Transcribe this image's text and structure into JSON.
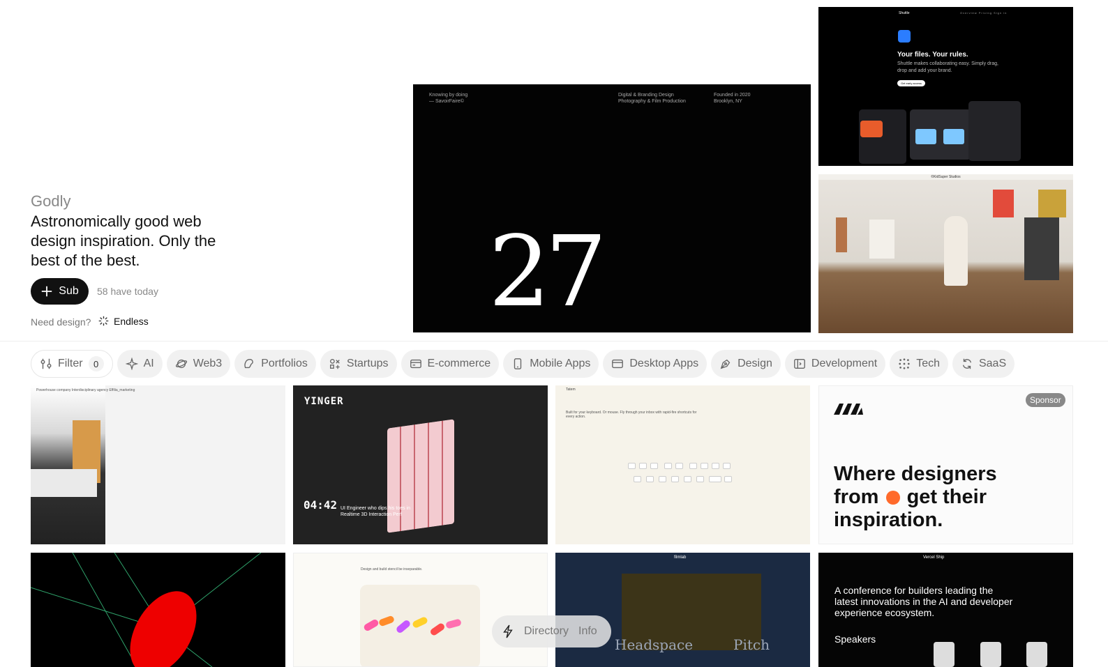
{
  "hero": {
    "brand": "Godly",
    "tagline": "Astronomically good web design inspiration. Only the best of the best.",
    "subscribe_label": "Sub",
    "sub_count": "58 have today",
    "need_design": "Need design?",
    "endless_label": "Endless"
  },
  "featured": {
    "main": {
      "top_left": "Knowing by doing\n— SavoirFaire©",
      "top_mid": "Digital & Branding Design\nPhotography & Film Production",
      "top_right": "Founded in 2020\nBrooklyn, NY",
      "big_number": "27"
    },
    "side_top": {
      "logo": "Shuttle",
      "nav": "Overview   Pricing   Sign in",
      "headline": "Your files. Your rules.",
      "body": "Shuttle makes collaborating easy. Simply drag, drop and add your brand.",
      "cta": "Get early access"
    },
    "side_bottom": {
      "bar": "©KidSuper Studios"
    }
  },
  "filters": {
    "filter_label": "Filter",
    "filter_count": "0",
    "items": [
      {
        "label": "AI",
        "icon": "sparkle-icon"
      },
      {
        "label": "Web3",
        "icon": "planet-icon"
      },
      {
        "label": "Portfolios",
        "icon": "portfolio-icon"
      },
      {
        "label": "Startups",
        "icon": "startup-icon"
      },
      {
        "label": "E-commerce",
        "icon": "card-icon"
      },
      {
        "label": "Mobile Apps",
        "icon": "phone-icon"
      },
      {
        "label": "Desktop Apps",
        "icon": "window-icon"
      },
      {
        "label": "Design",
        "icon": "pen-icon"
      },
      {
        "label": "Development",
        "icon": "code-icon"
      },
      {
        "label": "Tech",
        "icon": "dots-icon"
      },
      {
        "label": "SaaS",
        "icon": "refresh-icon"
      }
    ]
  },
  "grid": {
    "card1": {
      "text": "Powerhouse company   Interdisciplinary agency   Effilia_marketing"
    },
    "card2": {
      "logo": "YINGER",
      "time": "04:42",
      "caption": "UI Engineer who dips his toes in Realtime 3D Interaction Perf"
    },
    "card3": {
      "logo": "Tatem",
      "heading": "Built for your keyboard. Or mouse. Fly through your inbox with rapid-fire shortcuts for every action."
    },
    "card4": {
      "badge": "Sponsor",
      "headline_a": "Where designers from",
      "headline_b": "get their inspiration."
    },
    "card6": {
      "text": "Design and build stencil be inseparable."
    },
    "card7": {
      "top": "filmlab",
      "left": "Headspace",
      "right": "Pitch"
    },
    "card8": {
      "top": "Vercel Ship",
      "headline": "A conference for builders leading the latest innovations in the AI and developer experience ecosystem.",
      "speakers": "Speakers"
    }
  },
  "bottom_pill": {
    "directory_label": "Directory",
    "info_label": "Info"
  }
}
